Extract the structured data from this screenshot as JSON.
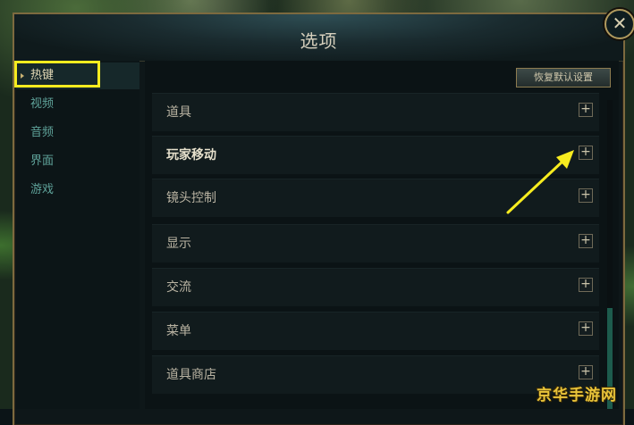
{
  "panel": {
    "title": "选项",
    "close_symbol": "✕"
  },
  "sidebar": {
    "items": [
      {
        "label": "热键",
        "active": true
      },
      {
        "label": "视频"
      },
      {
        "label": "音频"
      },
      {
        "label": "界面"
      },
      {
        "label": "游戏"
      }
    ]
  },
  "toolbar": {
    "restore_defaults": "恢复默认设置"
  },
  "categories": [
    {
      "label": "道具",
      "expand": "+"
    },
    {
      "label": "玩家移动",
      "expand": "+"
    },
    {
      "label": "镜头控制",
      "expand": "+"
    },
    {
      "label": "显示",
      "expand": "+"
    },
    {
      "label": "交流",
      "expand": "+"
    },
    {
      "label": "菜单",
      "expand": "+"
    },
    {
      "label": "道具商店",
      "expand": "+"
    }
  ],
  "annotations": {
    "highlight_color": "#f7ec1f",
    "arrow_color": "#f7ec1f"
  },
  "watermark": {
    "text": "京华手游网"
  }
}
